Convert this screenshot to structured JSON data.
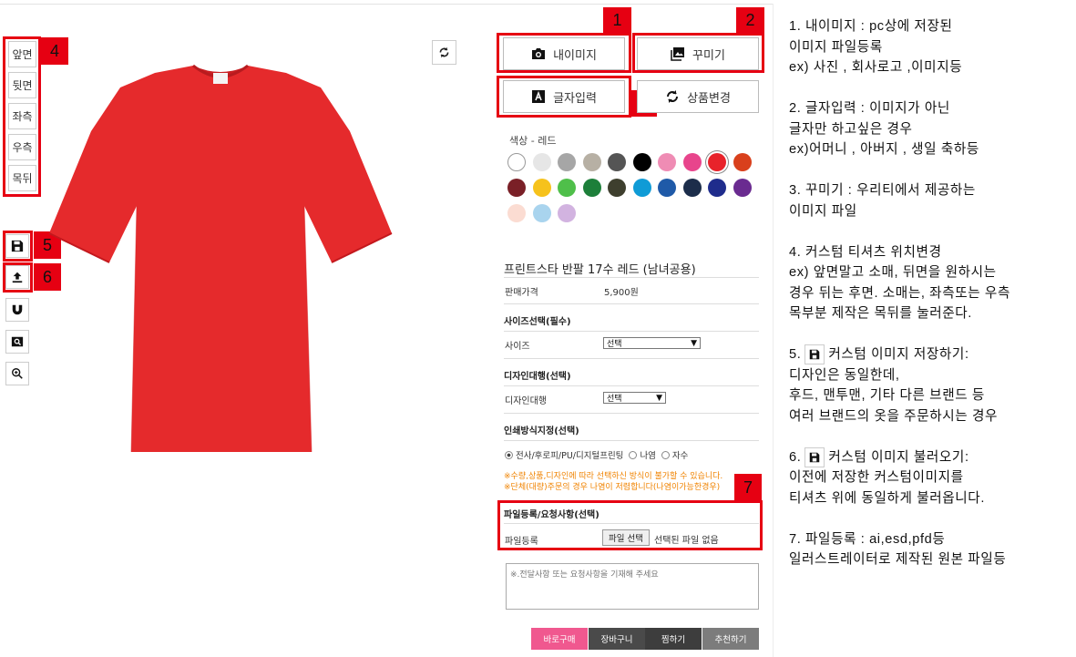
{
  "view_buttons": [
    "앞면",
    "뒷면",
    "좌측",
    "우측",
    "목뒤"
  ],
  "badges": {
    "b1": "1",
    "b2": "2",
    "b3": "3",
    "b4": "4",
    "b5": "5",
    "b6": "6",
    "b7": "7"
  },
  "actions": {
    "my_image": "내이미지",
    "decorate": "꾸미기",
    "text_input": "글자입력",
    "change_product": "상품변경"
  },
  "colors": {
    "title": "색상 - 레드",
    "swatches": [
      "#ffffff",
      "#e6e6e6",
      "#a6a6a6",
      "#b7b0a4",
      "#555555",
      "#000000",
      "#ef8cb4",
      "#e8458c",
      "#e8232b",
      "#d9401c",
      "#7a2027",
      "#f6c21c",
      "#4fbf4a",
      "#1d7f3a",
      "#3e3f2e",
      "#0f9bd6",
      "#1f5aa8",
      "#1c2d4a",
      "#1f2c8c",
      "#6a2b90",
      "#fbdcd2",
      "#a9d4ee",
      "#d2b3e0"
    ],
    "selected_index": 8
  },
  "product": {
    "name": "프린트스타 반팔 17수 레드 (남녀공용)",
    "price_label": "판매가격",
    "price": "5,900원",
    "size_section": "사이즈선택(필수)",
    "size_label": "사이즈",
    "size_value": "선택",
    "design_section": "디자인대행(선택)",
    "design_label": "디자인대행",
    "design_value": "선택",
    "print_section": "인쇄방식지정(선택)",
    "print_options": [
      "전사/후로피/PU/디지털프린팅",
      "나염",
      "자수"
    ],
    "notice1": "※수량,상품,디자인에 따라 선택하신 방식이 불가할 수 있습니다.",
    "notice2": "※단체(대량)주문의 경우 나염이 저렴합니다(나염이가능한경우)",
    "file_section": "파일등록/요청사항(선택)",
    "file_label": "파일등록",
    "file_button": "파일 선택",
    "file_status": "선택된 파일 없음",
    "memo_placeholder": "※.전달사항 또는 요청사항을 기재해 주세요"
  },
  "bottom": {
    "buy_now": "바로구매",
    "cart": "장바구니",
    "wish": "찜하기",
    "recommend": "추천하기"
  },
  "help": {
    "h1_l1": "1. 내이미지 : pc상에 저장된",
    "h1_l2": "이미지 파일등록",
    "h1_l3": "ex) 사진 , 회사로고 ,이미지등",
    "h2_l1": "2. 글자입력 : 이미지가 아닌",
    "h2_l2": "글자만 하고싶은 경우",
    "h2_l3": "ex)어머니 , 아버지 , 생일 축하등",
    "h3_l1": "3. 꾸미기 : 우리티에서 제공하는",
    "h3_l2": "이미지 파일",
    "h4_l1": "4. 커스텀 티셔츠 위치변경",
    "h4_l2": "ex) 앞면말고 소매, 뒤면을 원하시는",
    "h4_l3": "경우 뒤는 후면. 소매는, 좌측또는 우측",
    "h4_l4": "목부분 제작은 목뒤를 눌러준다.",
    "h5_pre": "5.",
    "h5_l1": "커스텀 이미지 저장하기:",
    "h5_l2": "디자인은 동일한데,",
    "h5_l3": "후드, 맨투맨, 기타 다른 브랜드 등",
    "h5_l4": "여러 브랜드의 옷을 주문하시는 경우",
    "h6_pre": "6.",
    "h6_l1": "커스텀 이미지 불러오기:",
    "h6_l2": "이전에 저장한 커스텀이미지를",
    "h6_l3": "티셔츠 위에 동일하게 불러옵니다.",
    "h7_l1": "7. 파일등록 : ai,esd,pfd등",
    "h7_l2": "일러스트레이터로 제작된 원본 파일등"
  }
}
